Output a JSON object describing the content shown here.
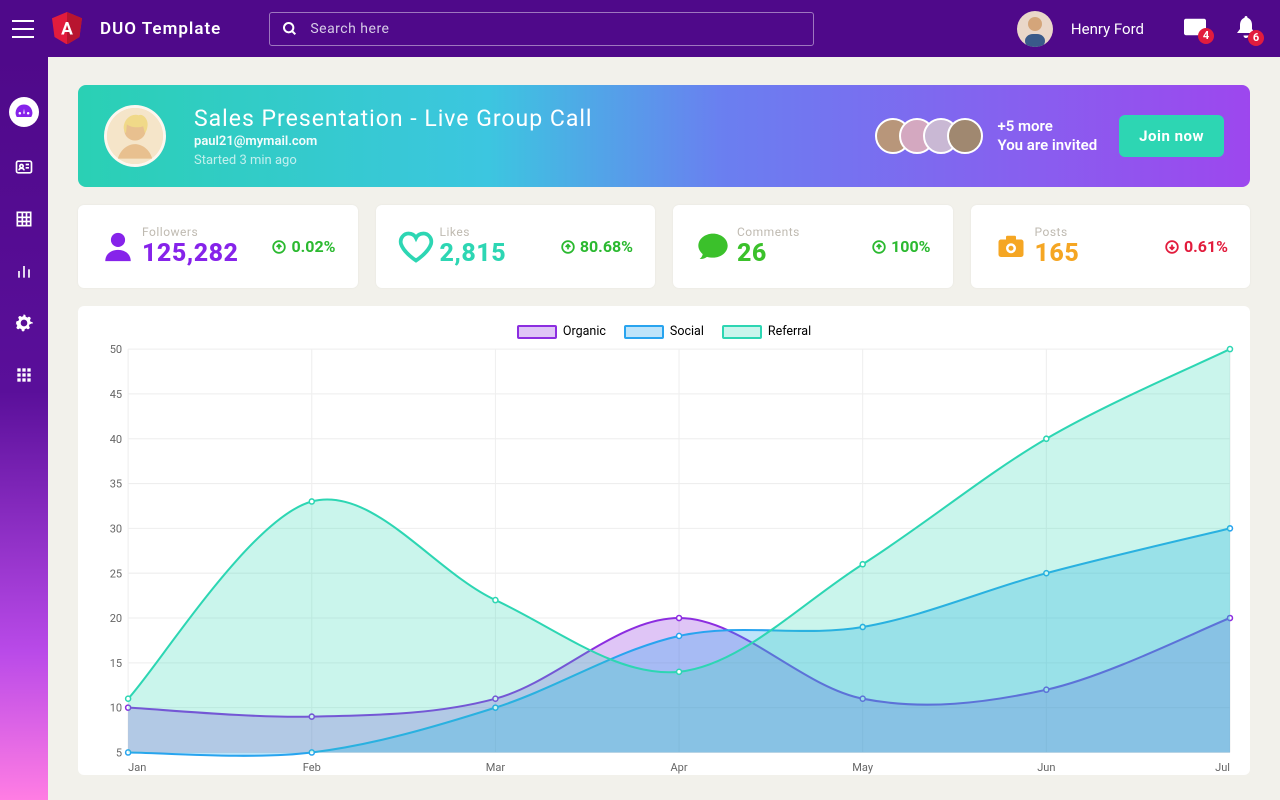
{
  "brand": "DUO Template",
  "search": {
    "placeholder": "Search here"
  },
  "user": {
    "name": "Henry Ford"
  },
  "topbadges": {
    "mail": "4",
    "bell": "6"
  },
  "banner": {
    "title": "Sales Presentation - Live Group Call",
    "email": "paul21@mymail.com",
    "time": "Started 3 min ago",
    "more": "+5 more",
    "invited": "You are invited",
    "join": "Join now"
  },
  "stats": {
    "followers": {
      "label": "Followers",
      "value": "125,282",
      "pct": "0.02%",
      "dir": "up",
      "color": "#8623ea"
    },
    "likes": {
      "label": "Likes",
      "value": "2,815",
      "pct": "80.68%",
      "dir": "up",
      "color": "#2dd6b3"
    },
    "comments": {
      "label": "Comments",
      "value": "26",
      "pct": "100%",
      "dir": "up",
      "color": "#3bc12b"
    },
    "posts": {
      "label": "Posts",
      "value": "165",
      "pct": "0.61%",
      "dir": "down",
      "color": "#f5a623"
    }
  },
  "chart_data": {
    "type": "area",
    "title": "",
    "xlabel": "",
    "ylabel": "",
    "ylim": [
      5,
      50
    ],
    "categories": [
      "Jan",
      "Feb",
      "Mar",
      "Apr",
      "May",
      "Jun",
      "Jul"
    ],
    "series": [
      {
        "name": "Organic",
        "color": "#8c2de0",
        "fill": "rgba(140,45,224,.28)",
        "values": [
          10,
          9,
          11,
          20,
          11,
          12,
          20
        ]
      },
      {
        "name": "Social",
        "color": "#28a4ef",
        "fill": "rgba(40,164,239,.30)",
        "values": [
          5,
          5,
          10,
          18,
          19,
          25,
          30
        ]
      },
      {
        "name": "Referral",
        "color": "#2dd6b3",
        "fill": "rgba(45,214,179,.25)",
        "values": [
          11,
          33,
          22,
          14,
          26,
          40,
          50
        ]
      }
    ]
  }
}
